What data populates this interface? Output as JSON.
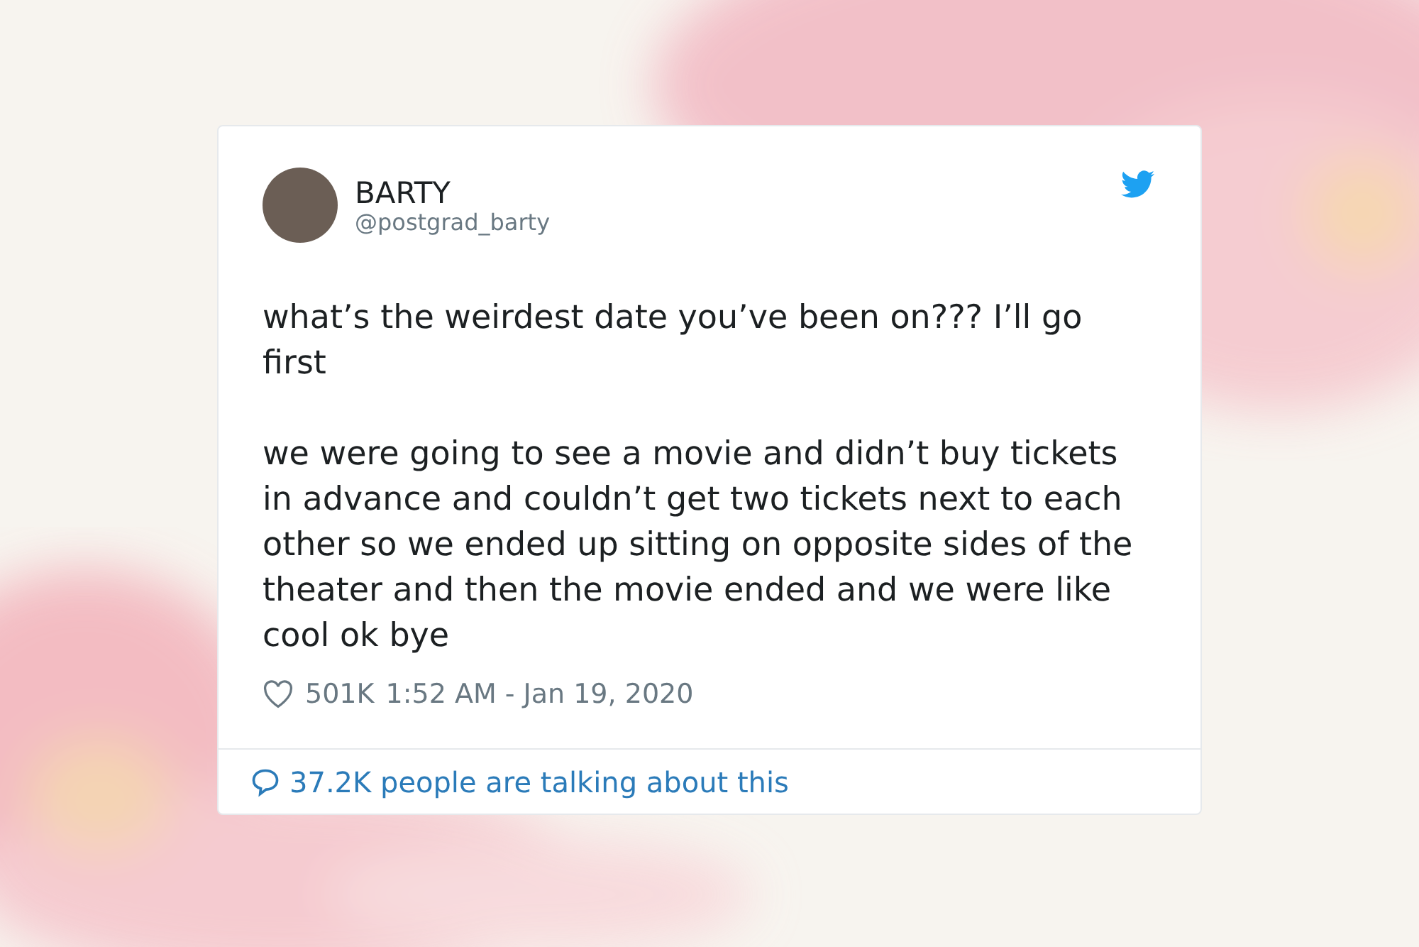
{
  "tweet": {
    "author": {
      "name": "BARTY",
      "handle": "@postgrad_barty"
    },
    "paragraphs": [
      "what’s the weirdest date you’ve been on??? I’ll go first",
      "we were going to see a movie and didn’t buy tickets in advance and couldn’t get two tickets next to each other so we ended up sitting on opposite sides of the theater and then the movie ended and we were like cool ok bye"
    ],
    "likes": "501K",
    "timestamp": "1:52 AM - Jan 19, 2020",
    "conversation": "37.2K people are talking about this"
  }
}
